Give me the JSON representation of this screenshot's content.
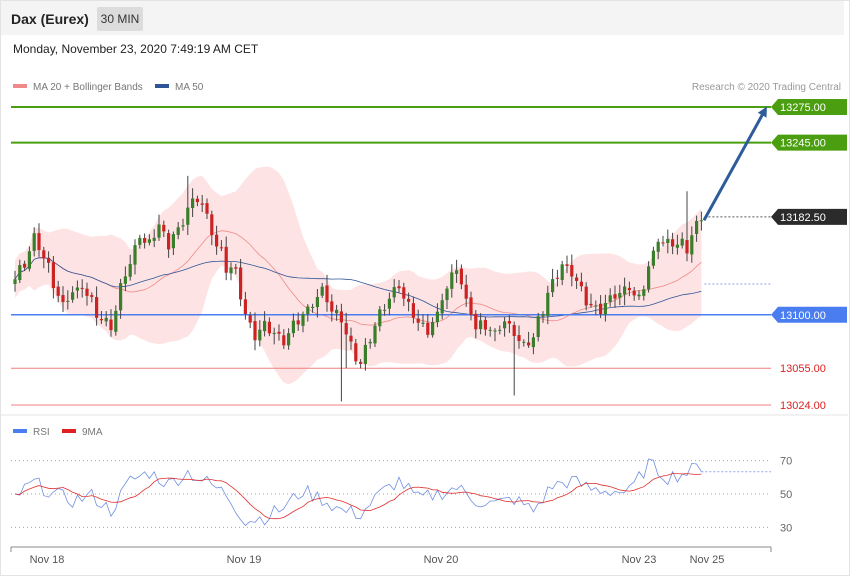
{
  "header": {
    "title": "Dax (Eurex)",
    "timeframe": "30 MIN",
    "timestamp": "Monday, November 23, 2020 7:49:19 AM CET"
  },
  "colors": {
    "bb_fill": "#fde3e3",
    "ma20": "#f08a8a",
    "ma50": "#2f5597",
    "up_candle": "#3a7d2a",
    "down_candle": "#cc2222",
    "resistance": "#4a9e10",
    "pivot": "#4a7df0",
    "support": "#f08080",
    "support_text": "#dd2222",
    "current_price_bg": "#2b2b2b",
    "arrow": "#2e5c9a",
    "rsi": "#7090e0",
    "rsi_ma": "#e03030"
  },
  "legend": {
    "items": [
      {
        "label": "MA 20 + Bollinger Bands",
        "color": "#f08a8a"
      },
      {
        "label": "MA 50",
        "color": "#2f5597"
      }
    ],
    "copyright": "Research © 2020 Trading Central"
  },
  "rsi_legend": {
    "items": [
      {
        "label": "RSI",
        "color": "#4a7df0"
      },
      {
        "label": "9MA",
        "color": "#e02020"
      }
    ]
  },
  "chart_data": [
    {
      "type": "candlestick",
      "title": "",
      "ylim": [
        13005,
        13292
      ],
      "levels": [
        {
          "value": 13275.0,
          "label": "13275.00",
          "kind": "resistance"
        },
        {
          "value": 13245.0,
          "label": "13245.00",
          "kind": "resistance"
        },
        {
          "value": 13182.5,
          "label": "13182.50",
          "kind": "current"
        },
        {
          "value": 13100.0,
          "label": "13100.00",
          "kind": "pivot"
        },
        {
          "value": 13055.0,
          "label": "13055.00",
          "kind": "support"
        },
        {
          "value": 13024.0,
          "label": "13024.00",
          "kind": "support"
        }
      ],
      "forecast_target": 13275,
      "x_ticks": [
        "Nov 18",
        "Nov 19",
        "Nov 20",
        "Nov 23",
        "Nov 25"
      ],
      "anchors": [
        [
          0,
          13130
        ],
        [
          2,
          13145
        ],
        [
          4,
          13165
        ],
        [
          6,
          13150
        ],
        [
          8,
          13125
        ],
        [
          10,
          13108
        ],
        [
          12,
          13118
        ],
        [
          14,
          13125
        ],
        [
          16,
          13110
        ],
        [
          18,
          13095
        ],
        [
          20,
          13092
        ],
        [
          22,
          13120
        ],
        [
          24,
          13145
        ],
        [
          26,
          13165
        ],
        [
          28,
          13160
        ],
        [
          30,
          13175
        ],
        [
          32,
          13160
        ],
        [
          34,
          13170
        ],
        [
          36,
          13190
        ],
        [
          38,
          13200
        ],
        [
          40,
          13182
        ],
        [
          42,
          13160
        ],
        [
          44,
          13140
        ],
        [
          46,
          13135
        ],
        [
          48,
          13100
        ],
        [
          50,
          13080
        ],
        [
          52,
          13093
        ],
        [
          54,
          13085
        ],
        [
          56,
          13080
        ],
        [
          58,
          13090
        ],
        [
          60,
          13098
        ],
        [
          62,
          13110
        ],
        [
          64,
          13120
        ],
        [
          66,
          13103
        ],
        [
          68,
          13098
        ],
        [
          70,
          13072
        ],
        [
          72,
          13060
        ],
        [
          74,
          13078
        ],
        [
          76,
          13098
        ],
        [
          78,
          13112
        ],
        [
          80,
          13125
        ],
        [
          82,
          13108
        ],
        [
          84,
          13095
        ],
        [
          86,
          13085
        ],
        [
          88,
          13100
        ],
        [
          90,
          13125
        ],
        [
          92,
          13140
        ],
        [
          94,
          13112
        ],
        [
          96,
          13088
        ],
        [
          98,
          13090
        ],
        [
          100,
          13085
        ],
        [
          102,
          13092
        ],
        [
          104,
          13088
        ],
        [
          106,
          13072
        ],
        [
          108,
          13080
        ],
        [
          110,
          13105
        ],
        [
          112,
          13128
        ],
        [
          114,
          13145
        ],
        [
          116,
          13135
        ],
        [
          118,
          13118
        ],
        [
          120,
          13108
        ],
        [
          122,
          13105
        ],
        [
          124,
          13115
        ],
        [
          126,
          13120
        ],
        [
          128,
          13122
        ],
        [
          130,
          13115
        ],
        [
          132,
          13140
        ],
        [
          134,
          13165
        ],
        [
          136,
          13160
        ],
        [
          138,
          13162
        ],
        [
          140,
          13155
        ],
        [
          142,
          13176
        ],
        [
          143,
          13180
        ]
      ]
    },
    {
      "type": "line",
      "title": "",
      "series": [
        {
          "name": "RSI"
        },
        {
          "name": "9MA"
        }
      ],
      "ylim": [
        20,
        80
      ],
      "y_ticks": [
        70,
        50,
        30
      ],
      "rsi_anchors": [
        [
          0,
          48
        ],
        [
          4,
          57
        ],
        [
          8,
          50
        ],
        [
          12,
          46
        ],
        [
          16,
          49
        ],
        [
          20,
          40
        ],
        [
          24,
          58
        ],
        [
          28,
          63
        ],
        [
          32,
          56
        ],
        [
          36,
          63
        ],
        [
          40,
          57
        ],
        [
          44,
          50
        ],
        [
          48,
          34
        ],
        [
          52,
          36
        ],
        [
          56,
          42
        ],
        [
          60,
          52
        ],
        [
          64,
          47
        ],
        [
          68,
          40
        ],
        [
          72,
          38
        ],
        [
          76,
          50
        ],
        [
          80,
          58
        ],
        [
          84,
          47
        ],
        [
          88,
          50
        ],
        [
          92,
          54
        ],
        [
          96,
          46
        ],
        [
          100,
          44
        ],
        [
          104,
          47
        ],
        [
          108,
          40
        ],
        [
          112,
          55
        ],
        [
          116,
          58
        ],
        [
          120,
          53
        ],
        [
          124,
          52
        ],
        [
          128,
          51
        ],
        [
          132,
          68
        ],
        [
          136,
          60
        ],
        [
          140,
          63
        ],
        [
          143,
          67
        ]
      ]
    }
  ]
}
